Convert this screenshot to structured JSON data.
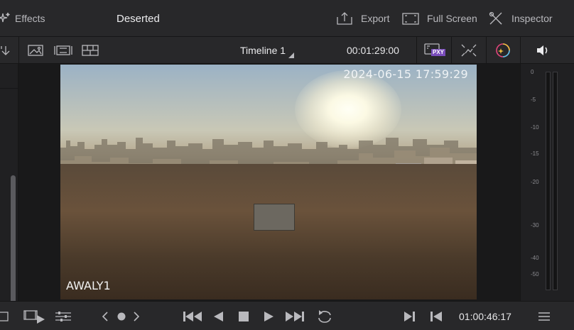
{
  "topbar": {
    "effects_label": "Effects",
    "project_title": "Deserted",
    "export_label": "Export",
    "fullscreen_label": "Full Screen",
    "inspector_label": "Inspector"
  },
  "viewer_header": {
    "timeline_name": "Timeline 1",
    "source_timecode": "00:01:29:00",
    "proxy_badge": "PXY"
  },
  "video": {
    "timestamp_overlay": "2024-06-15 17:59:29",
    "camera_label": "AWALY1"
  },
  "audio_meter": {
    "ticks": [
      "0",
      "-5",
      "-10",
      "-15",
      "-20",
      "-30",
      "-40",
      "-50"
    ]
  },
  "transport": {
    "timecode": "01:00:46:17"
  },
  "icons": {
    "effects": "sparkle-icon",
    "export": "export-icon",
    "fullscreen": "fullscreen-icon",
    "inspector": "inspector-icon",
    "volume": "speaker-icon"
  },
  "colors": {
    "panel_bg": "#28282a",
    "viewer_bg": "#19191a",
    "proxy_badge_bg": "#7a4dbb"
  }
}
